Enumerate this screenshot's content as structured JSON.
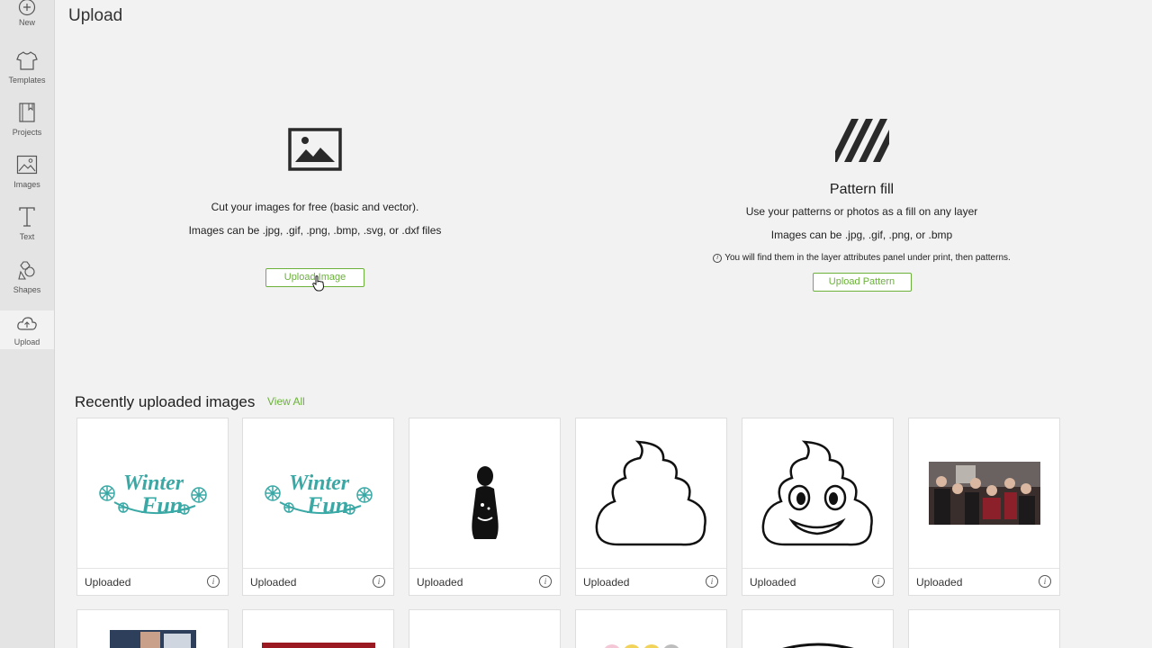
{
  "sidebar": {
    "items": [
      {
        "label": "New",
        "icon": "plus-circle-icon"
      },
      {
        "label": "Templates",
        "icon": "tshirt-icon"
      },
      {
        "label": "Projects",
        "icon": "book-icon"
      },
      {
        "label": "Images",
        "icon": "image-icon"
      },
      {
        "label": "Text",
        "icon": "text-icon"
      },
      {
        "label": "Shapes",
        "icon": "shapes-icon"
      },
      {
        "label": "Upload",
        "icon": "cloud-upload-icon"
      }
    ],
    "active": "Upload"
  },
  "header": {
    "title": "Upload"
  },
  "upload_image": {
    "line1": "Cut your images for free (basic and vector).",
    "line2": "Images can be .jpg, .gif, .png, .bmp, .svg, or .dxf files",
    "button": "Upload Image"
  },
  "pattern": {
    "title": "Pattern fill",
    "line1": "Use your patterns or photos as a fill on any layer",
    "line2": "Images can be .jpg, .gif, .png, or .bmp",
    "note": "You will find them in the layer attributes panel under print, then patterns.",
    "button": "Upload Pattern"
  },
  "recent": {
    "title": "Recently uploaded images",
    "view_all": "View All",
    "cards": [
      {
        "status": "Uploaded",
        "thumb": "Winter Fun"
      },
      {
        "status": "Uploaded",
        "thumb": "Winter Fun"
      },
      {
        "status": "Uploaded",
        "thumb": "woman silhouette"
      },
      {
        "status": "Uploaded",
        "thumb": "poop outline"
      },
      {
        "status": "Uploaded",
        "thumb": "poop emoji"
      },
      {
        "status": "Uploaded",
        "thumb": "group photo"
      }
    ]
  },
  "colors": {
    "accent": "#6bb13a",
    "teal": "#3aa9a6",
    "sidebar_bg": "#e4e4e4"
  }
}
